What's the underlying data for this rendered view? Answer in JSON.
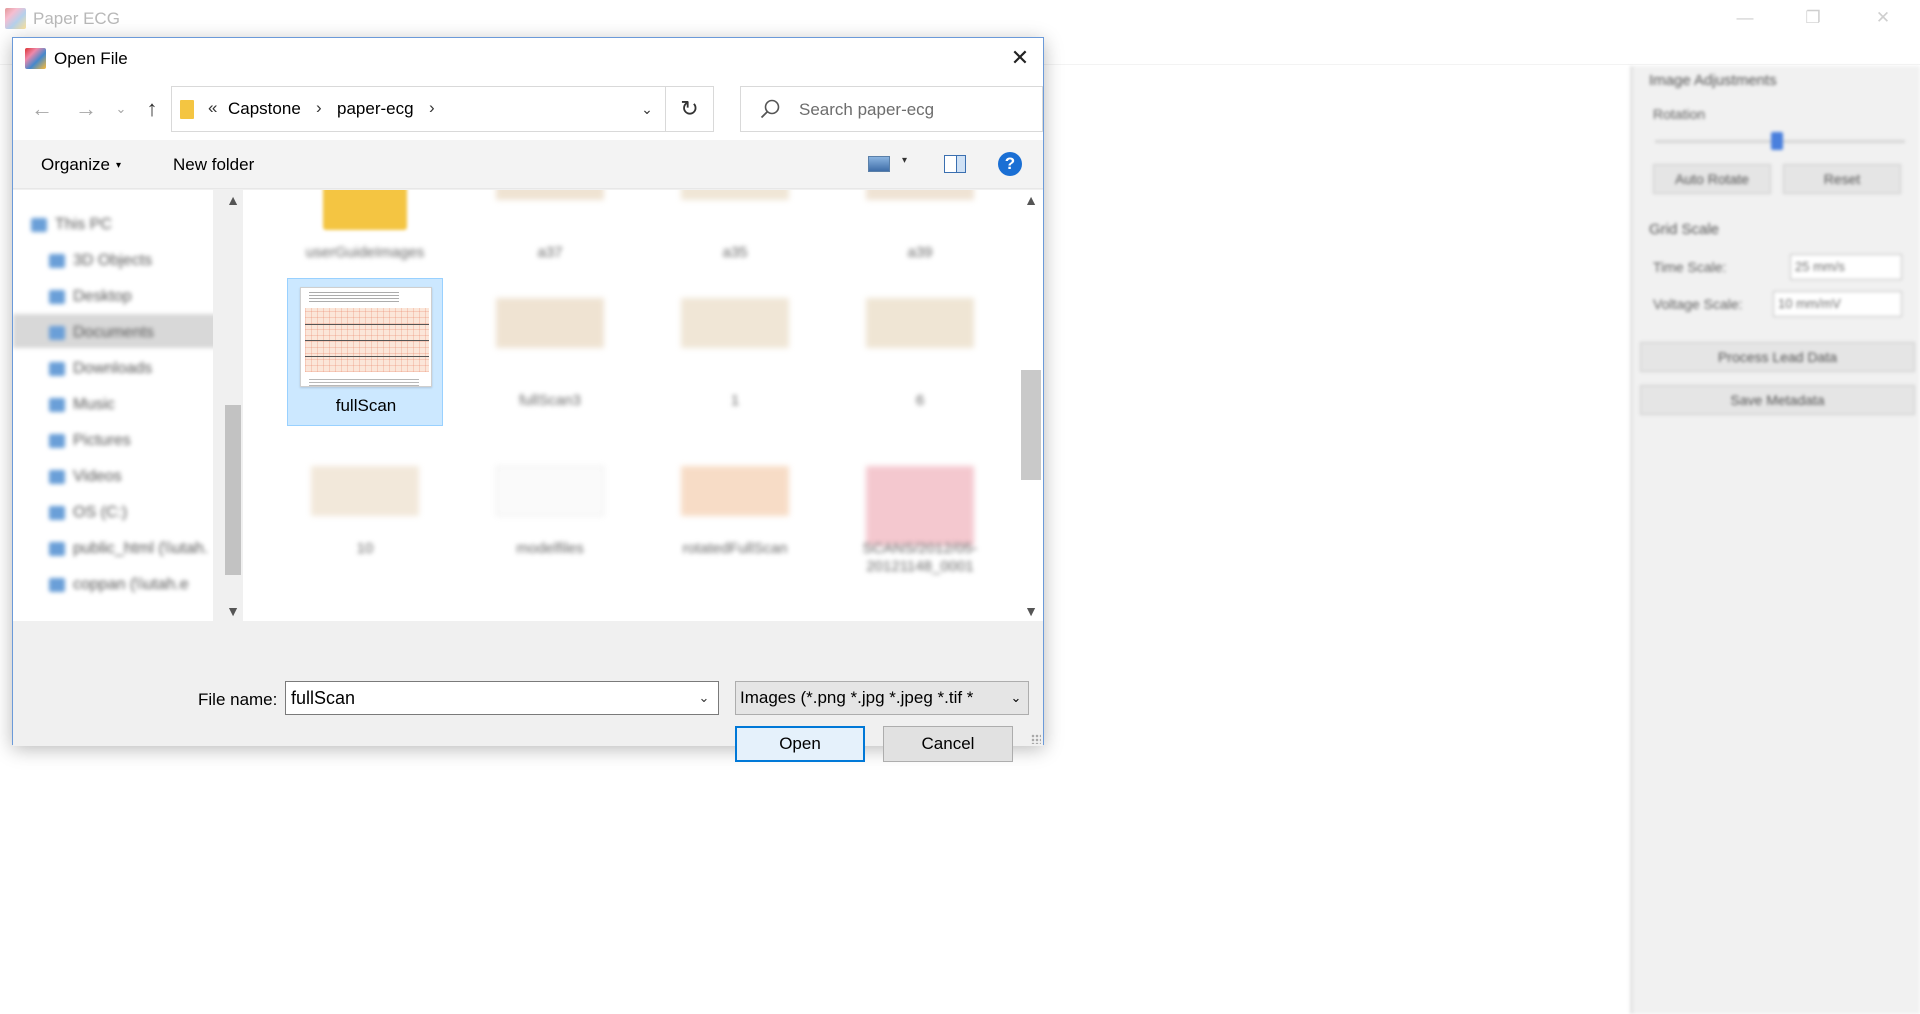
{
  "app": {
    "title": "Paper ECG",
    "window_controls": {
      "minimize": "—",
      "maximize": "❐",
      "close": "✕"
    },
    "panel": {
      "image_adjustments_heading": "Image Adjustments",
      "rotation_label": "Rotation",
      "auto_rotate_label": "Auto Rotate",
      "reset_label": "Reset",
      "grid_scale_heading": "Grid Scale",
      "time_scale_label": "Time Scale:",
      "time_scale_value": "25 mm/s",
      "voltage_scale_label": "Voltage Scale:",
      "voltage_scale_value": "10 mm/mV",
      "process_lead_data_label": "Process Lead Data",
      "save_metadata_label": "Save Metadata"
    }
  },
  "dialog": {
    "title": "Open File",
    "close_glyph": "✕",
    "nav": {
      "back": "←",
      "forward": "→",
      "recent": "⌄",
      "up": "↑"
    },
    "address": {
      "overflow": "«",
      "parts": [
        "Capstone",
        "paper-ecg"
      ],
      "sep": "›",
      "dropdown": "⌄",
      "refresh": "↻"
    },
    "search": {
      "placeholder": "Search paper-ecg",
      "icon": "search-icon"
    },
    "toolbar": {
      "organize_label": "Organize",
      "new_folder_label": "New folder",
      "caret": "▾",
      "help": "?"
    },
    "nav_pane": {
      "items": [
        "This PC",
        "3D Objects",
        "Desktop",
        "Documents",
        "Downloads",
        "Music",
        "Pictures",
        "Videos",
        "OS (C:)",
        "public_html (\\\\utah.",
        "coppan (\\\\utah.e"
      ],
      "selected_index": 3
    },
    "files": [
      {
        "name": "userGuideImages",
        "kind": "folder"
      },
      {
        "name": "a37",
        "kind": "image"
      },
      {
        "name": "a35",
        "kind": "image"
      },
      {
        "name": "a39",
        "kind": "image"
      },
      {
        "name": "fullScan",
        "kind": "image",
        "selected": true
      },
      {
        "name": "fullScan3",
        "kind": "image"
      },
      {
        "name": "1",
        "kind": "image"
      },
      {
        "name": "6",
        "kind": "image"
      },
      {
        "name": "10",
        "kind": "image"
      },
      {
        "name": "modelfiles",
        "kind": "image"
      },
      {
        "name": "rotatedFullScan",
        "kind": "image"
      },
      {
        "name": "SCANS/2012/05-20121148_0001",
        "kind": "image"
      }
    ],
    "file_name_label": "File name:",
    "file_name_value": "fullScan",
    "file_type_value": "Images (*.png *.jpg *.jpeg *.tif *",
    "open_label": "Open",
    "cancel_label": "Cancel",
    "scroll": {
      "up": "▲",
      "down": "▼"
    },
    "colors": {
      "selection": "#cce8ff",
      "accent": "#0078d7",
      "folder": "#f4c542"
    }
  }
}
